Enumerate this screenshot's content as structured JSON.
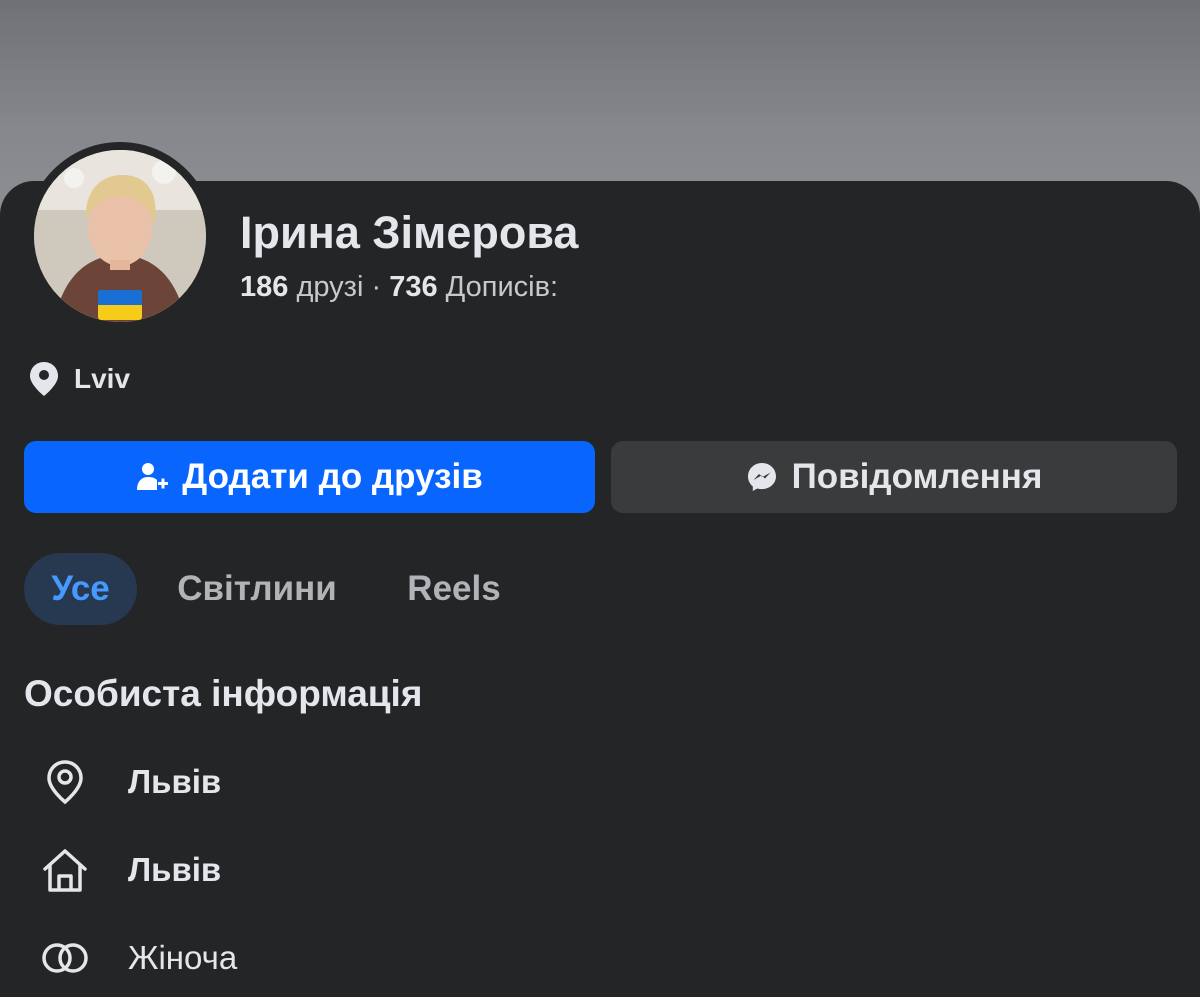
{
  "profile": {
    "name": "Ірина Зімерова",
    "friends_count": "186",
    "friends_label": "друзі",
    "separator": "·",
    "posts_count": "736",
    "posts_label": "Дописів:",
    "location": "Lviv"
  },
  "actions": {
    "add_friend": "Додати до друзів",
    "message": "Повідомлення"
  },
  "tabs": [
    {
      "label": "Усе",
      "active": true
    },
    {
      "label": "Світлини",
      "active": false
    },
    {
      "label": "Reels",
      "active": false
    }
  ],
  "personal_info": {
    "title": "Особиста інформація",
    "items": [
      {
        "icon": "location-pin-icon",
        "text": "Львів"
      },
      {
        "icon": "home-icon",
        "text": "Львів"
      },
      {
        "icon": "gender-rings-icon",
        "text": "Жіноча"
      }
    ]
  },
  "colors": {
    "background": "#242526",
    "primary_button": "#0866ff",
    "secondary_button": "#3a3b3c",
    "active_tab_bg": "#263951",
    "active_tab_text": "#4599ff",
    "flag_blue": "#1a6fd6",
    "flag_yellow": "#f6cc1b"
  }
}
